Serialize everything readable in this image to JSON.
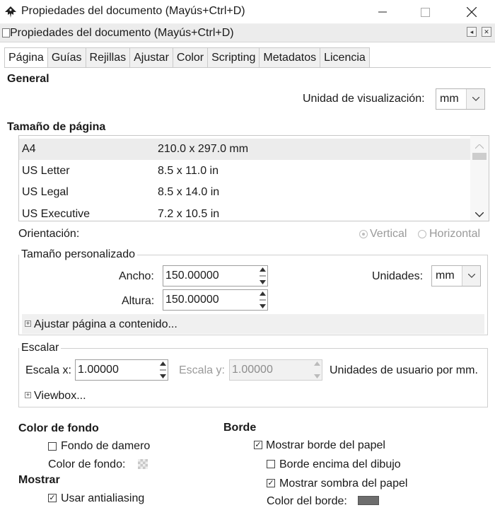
{
  "window": {
    "title": "Propiedades del documento (Mayús+Ctrl+D)",
    "controls": [
      "minimize-icon",
      "maximize-icon",
      "close-icon"
    ]
  },
  "dock": {
    "title": "Propiedades del documento (Mayús+Ctrl+D)"
  },
  "tabs": [
    "Página",
    "Guías",
    "Rejillas",
    "Ajustar",
    "Color",
    "Scripting",
    "Metadatos",
    "Licencia"
  ],
  "general": {
    "heading": "General",
    "display_unit_label": "Unidad de visualización:",
    "display_unit_value": "mm"
  },
  "page_size": {
    "heading": "Tamaño de página",
    "rows": [
      {
        "name": "A4",
        "size": "210.0 x 297.0 mm"
      },
      {
        "name": "US Letter",
        "size": "8.5 x 11.0 in"
      },
      {
        "name": "US Legal",
        "size": "8.5 x 14.0 in"
      },
      {
        "name": "US Executive",
        "size": "7.2 x 10.5 in"
      }
    ],
    "selected_row": "A4"
  },
  "orientation": {
    "label": "Orientación:",
    "vertical": "Vertical",
    "horizontal": "Horizontal",
    "selected": "Vertical"
  },
  "custom_size": {
    "heading": "Tamaño personalizado",
    "width_label": "Ancho:",
    "width_value": "150.00000",
    "height_label": "Altura:",
    "height_value": "150.00000",
    "units_label": "Unidades:",
    "units_value": "mm",
    "fit_label": "Ajustar página a contenido..."
  },
  "scale": {
    "heading": "Escalar",
    "scale_x_label": "Escala x:",
    "scale_x_value": "1.00000",
    "scale_y_label": "Escala y:",
    "scale_y_value": "1.00000",
    "units_text": "Unidades de usuario por mm.",
    "viewbox_label": "Viewbox..."
  },
  "background": {
    "heading": "Color de fondo",
    "checkerboard_label": "Fondo de damero",
    "checkerboard_checked": false,
    "color_label": "Color de fondo:"
  },
  "display": {
    "heading": "Mostrar",
    "antialias_label": "Usar antialiasing",
    "antialias_checked": true
  },
  "border": {
    "heading": "Borde",
    "show_border_label": "Mostrar borde del papel",
    "show_border_checked": true,
    "border_on_top_label": "Borde encima del dibujo",
    "border_on_top_checked": false,
    "show_shadow_label": "Mostrar sombra del papel",
    "show_shadow_checked": true,
    "border_color_label": "Color del borde:",
    "border_color": "#6d6d6d"
  },
  "colors": {
    "selected_row": "#ececec",
    "frame_border": "#cfcfcf",
    "tab_active": "#ffffff",
    "tab_inactive": "#f0f0f0"
  }
}
